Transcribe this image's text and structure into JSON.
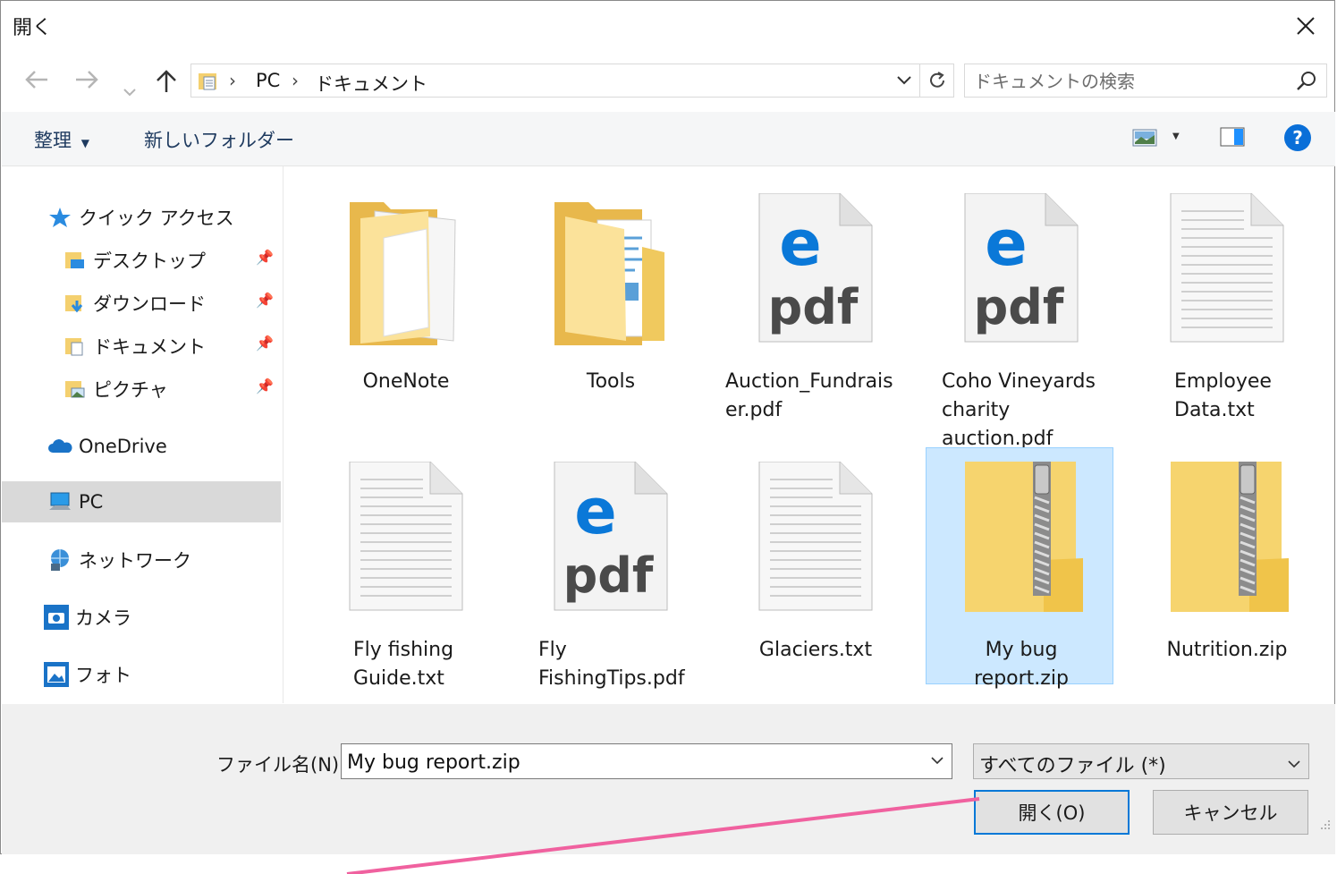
{
  "window": {
    "title": "開く"
  },
  "address": {
    "segments": [
      "PC",
      "ドキュメント"
    ]
  },
  "search": {
    "placeholder": "ドキュメントの検索"
  },
  "toolbar": {
    "organize": "整理",
    "new_folder": "新しいフォルダー"
  },
  "sidebar": {
    "quick_access": "クイック アクセス",
    "items": [
      {
        "label": "デスクトップ"
      },
      {
        "label": "ダウンロード"
      },
      {
        "label": "ドキュメント"
      },
      {
        "label": "ピクチャ"
      }
    ],
    "onedrive": "OneDrive",
    "pc": "PC",
    "network": "ネットワーク",
    "camera": "カメラ",
    "photos": "フォト"
  },
  "files": [
    {
      "name": "OneNote",
      "type": "folder-docs"
    },
    {
      "name": "Tools",
      "type": "folder-tools"
    },
    {
      "name": "Auction_Fundraiser.pdf",
      "type": "pdf"
    },
    {
      "name": "Coho Vineyards charity auction.pdf",
      "type": "pdf"
    },
    {
      "name": "Employee Data.txt",
      "type": "txt"
    },
    {
      "name": "Fly fishing Guide.txt",
      "type": "txt"
    },
    {
      "name": "Fly FishingTips.pdf",
      "type": "pdf"
    },
    {
      "name": "Glaciers.txt",
      "type": "txt"
    },
    {
      "name": "My bug report.zip",
      "type": "zip",
      "selected": true
    },
    {
      "name": "Nutrition.zip",
      "type": "zip"
    }
  ],
  "labels": {
    "f0": "OneNote",
    "f1": "Tools",
    "f2a": "Auction_Fundrais",
    "f2b": "er.pdf",
    "f3a": "Coho Vineyards",
    "f3b": "charity",
    "f3c": "auction.pdf",
    "f4a": "Employee",
    "f4b": "Data.txt",
    "f5a": "Fly fishing",
    "f5b": "Guide.txt",
    "f6a": "Fly",
    "f6b": "FishingTips.pdf",
    "f7": "Glaciers.txt",
    "f8a": "My bug",
    "f8b": "report.zip",
    "f9": "Nutrition.zip"
  },
  "bottom": {
    "filename_label": "ファイル名(N):",
    "filename_value": "My bug report.zip",
    "filetype_value": "すべてのファイル (*)",
    "open_button": "開く(O)",
    "cancel_button": "キャンセル"
  },
  "colors": {
    "accent": "#0078d7",
    "selection": "#cce8ff",
    "annotation": "#f0619f"
  }
}
